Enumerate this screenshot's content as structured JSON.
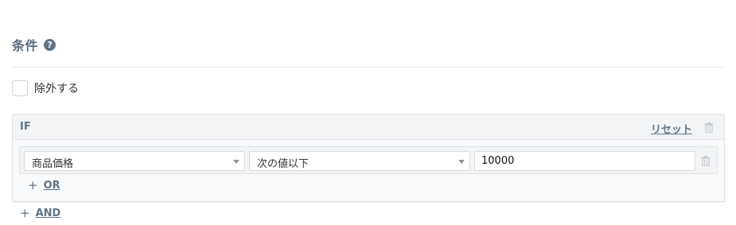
{
  "section": {
    "title": "条件",
    "help_glyph": "?"
  },
  "exclude": {
    "label": "除外する",
    "checked": false
  },
  "if_block": {
    "label": "IF",
    "reset_label": "リセット",
    "condition": {
      "field": "商品価格",
      "operator": "次の値以下",
      "value": "10000"
    },
    "or_plus": "+",
    "or_label": "OR"
  },
  "and_plus": "+",
  "and_label": "AND",
  "icons": {
    "help": "question-circle-icon",
    "delete": "trash-icon",
    "dropdown": "caret-down-icon"
  },
  "colors": {
    "accent": "#5f7384",
    "border": "#dfe3e6",
    "panel": "#f3f4f6"
  }
}
